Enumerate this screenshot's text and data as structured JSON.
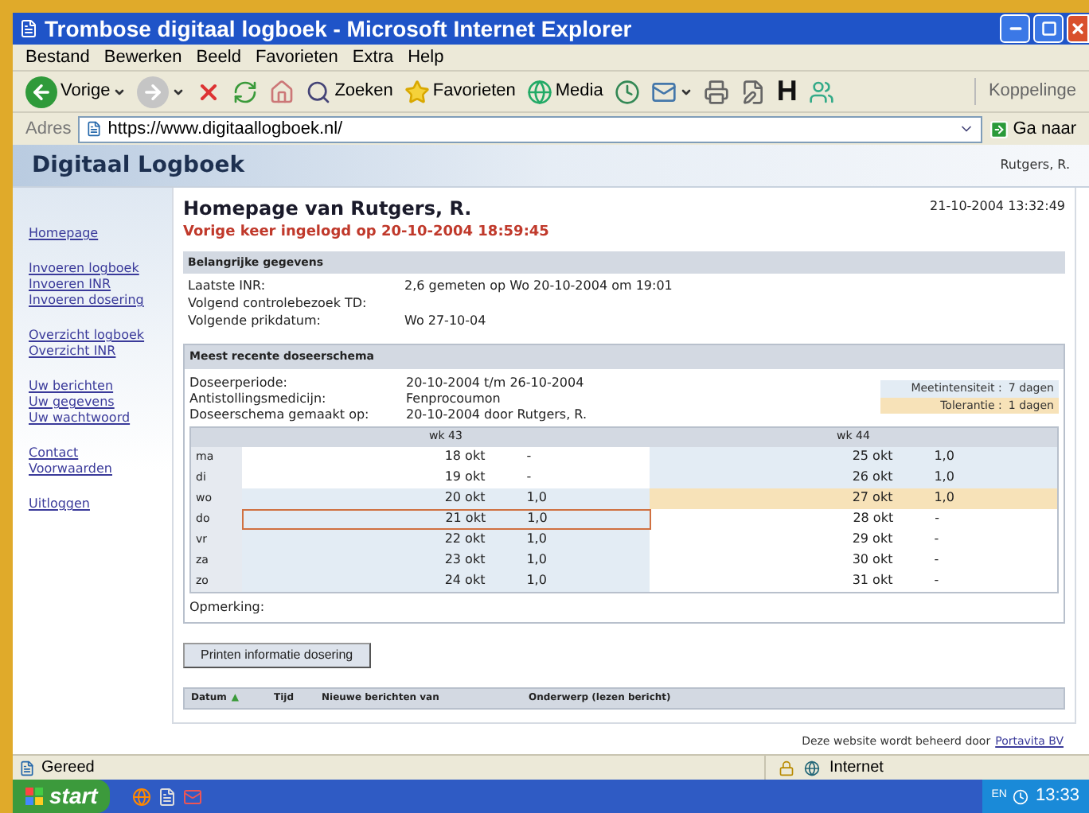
{
  "window": {
    "title": "Trombose digitaal logboek - Microsoft Internet Explorer"
  },
  "menu": [
    "Bestand",
    "Bewerken",
    "Beeld",
    "Favorieten",
    "Extra",
    "Help"
  ],
  "toolbar": [
    {
      "kind": "back",
      "label": "Vorige",
      "dropdown": true
    },
    {
      "kind": "forward",
      "dropdown": true
    },
    {
      "kind": "stop"
    },
    {
      "kind": "refresh"
    },
    {
      "kind": "home"
    },
    {
      "kind": "search",
      "label": "Zoeken"
    },
    {
      "kind": "favorites",
      "label": "Favorieten"
    },
    {
      "kind": "media",
      "label": "Media"
    },
    {
      "kind": "history"
    },
    {
      "kind": "mail",
      "dropdown": true
    },
    {
      "kind": "print"
    },
    {
      "kind": "edit"
    },
    {
      "kind": "letter",
      "label": "H"
    },
    {
      "kind": "messenger"
    }
  ],
  "links_label": "Koppelinge",
  "address": {
    "label": "Adres",
    "value": "https://www.digitaallogboek.nl/",
    "go": "Ga naar"
  },
  "site": {
    "brand": "Digitaal Logboek",
    "user": "Rutgers, R."
  },
  "sidebar": [
    [
      "Homepage"
    ],
    [
      "Invoeren logboek",
      "Invoeren INR",
      "Invoeren dosering"
    ],
    [
      "Overzicht logboek",
      "Overzicht INR"
    ],
    [
      "Uw berichten",
      "Uw gegevens",
      "Uw wachtwoord"
    ],
    [
      "Contact",
      "Voorwaarden"
    ],
    [
      "Uitloggen"
    ]
  ],
  "page": {
    "title": "Homepage van Rutgers, R.",
    "datetime": "21-10-2004 13:32:49",
    "last_login": "Vorige keer ingelogd op 20-10-2004 18:59:45"
  },
  "info": {
    "heading": "Belangrijke gegevens",
    "rows": [
      {
        "label": "Laatste INR:",
        "value": "2,6 gemeten op Wo 20-10-2004 om 19:01"
      },
      {
        "label": "Volgend controlebezoek TD:"
      },
      {
        "label": "Volgende prikdatum:",
        "value": "Wo 27-10-04"
      }
    ]
  },
  "schedule": {
    "heading": "Meest recente doseerschema",
    "rows": [
      {
        "label": "Doseerperiode:",
        "value": "20-10-2004 t/m 26-10-2004"
      },
      {
        "label": "Antistollingsmedicijn:",
        "value": "Fenprocoumon"
      },
      {
        "label": "Doseerschema gemaakt op:",
        "value": "20-10-2004 door Rutgers, R."
      }
    ],
    "legend": [
      {
        "kind": "measure",
        "label": "Meetintensiteit :",
        "value": "7 dagen"
      },
      {
        "kind": "tolerance",
        "label": "Tolerantie :",
        "value": "1 dagen"
      }
    ],
    "weeks": [
      "wk 43",
      "wk 44"
    ],
    "days": [
      {
        "day": "ma",
        "cells": [
          {
            "date": "18 okt",
            "dose": "-",
            "kind": "none",
            "today": false
          },
          {
            "date": "25 okt",
            "dose": "1,0",
            "kind": "measure",
            "today": false
          }
        ]
      },
      {
        "day": "di",
        "cells": [
          {
            "date": "19 okt",
            "dose": "-",
            "kind": "none",
            "today": false
          },
          {
            "date": "26 okt",
            "dose": "1,0",
            "kind": "measure",
            "today": false
          }
        ]
      },
      {
        "day": "wo",
        "cells": [
          {
            "date": "20 okt",
            "dose": "1,0",
            "kind": "measure",
            "today": false
          },
          {
            "date": "27 okt",
            "dose": "1,0",
            "kind": "tolerance",
            "today": false
          }
        ]
      },
      {
        "day": "do",
        "cells": [
          {
            "date": "21 okt",
            "dose": "1,0",
            "kind": "measure",
            "today": true
          },
          {
            "date": "28 okt",
            "dose": "-",
            "kind": "none",
            "today": false
          }
        ]
      },
      {
        "day": "vr",
        "cells": [
          {
            "date": "22 okt",
            "dose": "1,0",
            "kind": "measure",
            "today": false
          },
          {
            "date": "29 okt",
            "dose": "-",
            "kind": "none",
            "today": false
          }
        ]
      },
      {
        "day": "za",
        "cells": [
          {
            "date": "23 okt",
            "dose": "1,0",
            "kind": "measure",
            "today": false
          },
          {
            "date": "30 okt",
            "dose": "-",
            "kind": "none",
            "today": false
          }
        ]
      },
      {
        "day": "zo",
        "cells": [
          {
            "date": "24 okt",
            "dose": "1,0",
            "kind": "measure",
            "today": false
          },
          {
            "date": "31 okt",
            "dose": "-",
            "kind": "none",
            "today": false
          }
        ]
      }
    ],
    "remark_label": "Opmerking:"
  },
  "print_button": "Printen informatie dosering",
  "messages": {
    "columns": [
      {
        "label": "Datum",
        "sort": "▲"
      },
      {
        "label": "Tijd"
      },
      {
        "label": "Nieuwe berichten van"
      },
      {
        "label": "Onderwerp (lezen bericht)"
      }
    ]
  },
  "footer": {
    "text": "Deze website wordt beheerd door",
    "link": "Portavita BV"
  },
  "status": {
    "text": "Gereed",
    "zone": "Internet"
  },
  "taskbar": {
    "start": "start",
    "lang": "EN",
    "time": "13:33"
  }
}
